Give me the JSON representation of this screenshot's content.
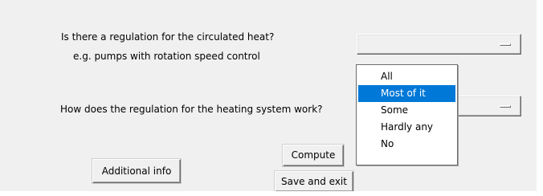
{
  "questions": {
    "q1_line1": "Is there a regulation for the circulated heat?",
    "q1_line2": "e.g. pumps with rotation speed control",
    "q2": "How does the regulation for the heating system work?"
  },
  "selects": {
    "q1_value": "",
    "q2_value": ""
  },
  "dropdown": {
    "open": true,
    "selected_index": 1,
    "options": [
      "All",
      "Most of it",
      "Some",
      "Hardly any",
      "No"
    ]
  },
  "buttons": {
    "compute": "Compute",
    "save_and_exit": "Save and exit",
    "additional_info": "Additional info"
  },
  "colors": {
    "window_bg": "#f0f0f0",
    "highlight": "#0078d7",
    "highlight_text": "#ffffff"
  },
  "icons": {
    "select_indicator": "option-menu-indicator-icon"
  }
}
